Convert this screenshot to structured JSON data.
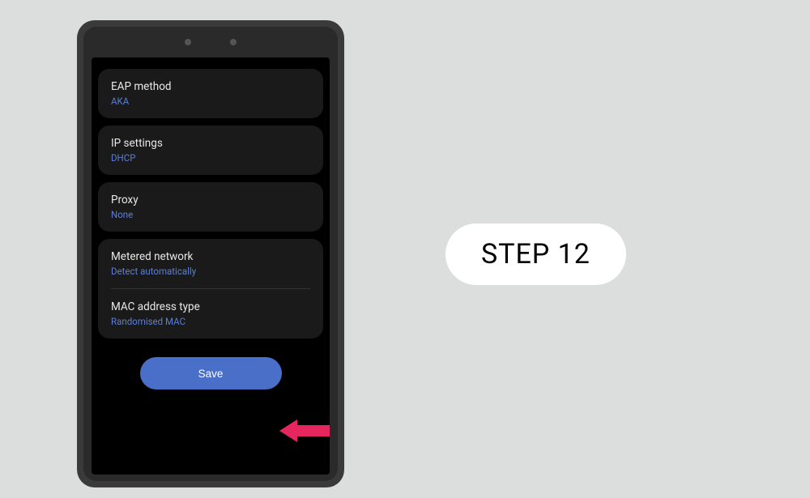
{
  "step_label": "STEP 12",
  "settings": {
    "eap": {
      "label": "EAP method",
      "value": "AKA"
    },
    "ip": {
      "label": "IP settings",
      "value": "DHCP"
    },
    "proxy": {
      "label": "Proxy",
      "value": "None"
    },
    "metered": {
      "label": "Metered network",
      "value": "Detect automatically"
    },
    "mac": {
      "label": "MAC address type",
      "value": "Randomised MAC"
    }
  },
  "save_button": "Save"
}
